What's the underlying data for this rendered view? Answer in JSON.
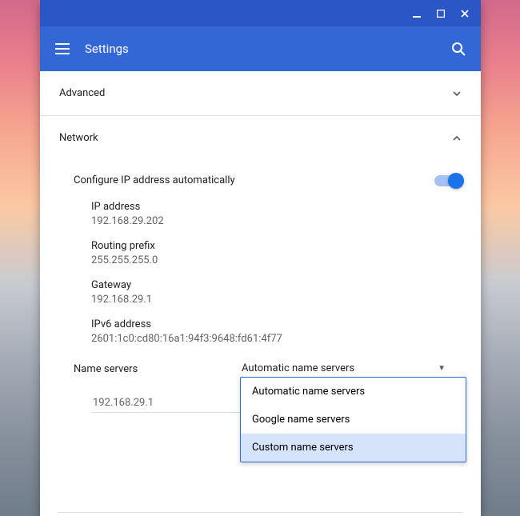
{
  "appbar": {
    "title": "Settings"
  },
  "sections": {
    "advanced": {
      "label": "Advanced"
    },
    "network": {
      "label": "Network"
    }
  },
  "toggle": {
    "label": "Configure IP address automatically"
  },
  "fields": {
    "ip": {
      "label": "IP address",
      "value": "192.168.29.202"
    },
    "prefix": {
      "label": "Routing prefix",
      "value": "255.255.255.0"
    },
    "gateway": {
      "label": "Gateway",
      "value": "192.168.29.1"
    },
    "ipv6": {
      "label": "IPv6 address",
      "value": "2601:1c0:cd80:16a1:94f3:9648:fd61:4f77"
    }
  },
  "nameservers": {
    "label": "Name servers",
    "selected": "Automatic name servers",
    "options": {
      "auto": "Automatic name servers",
      "google": "Google name servers",
      "custom": "Custom name servers"
    },
    "input_value": "192.168.29.1"
  }
}
